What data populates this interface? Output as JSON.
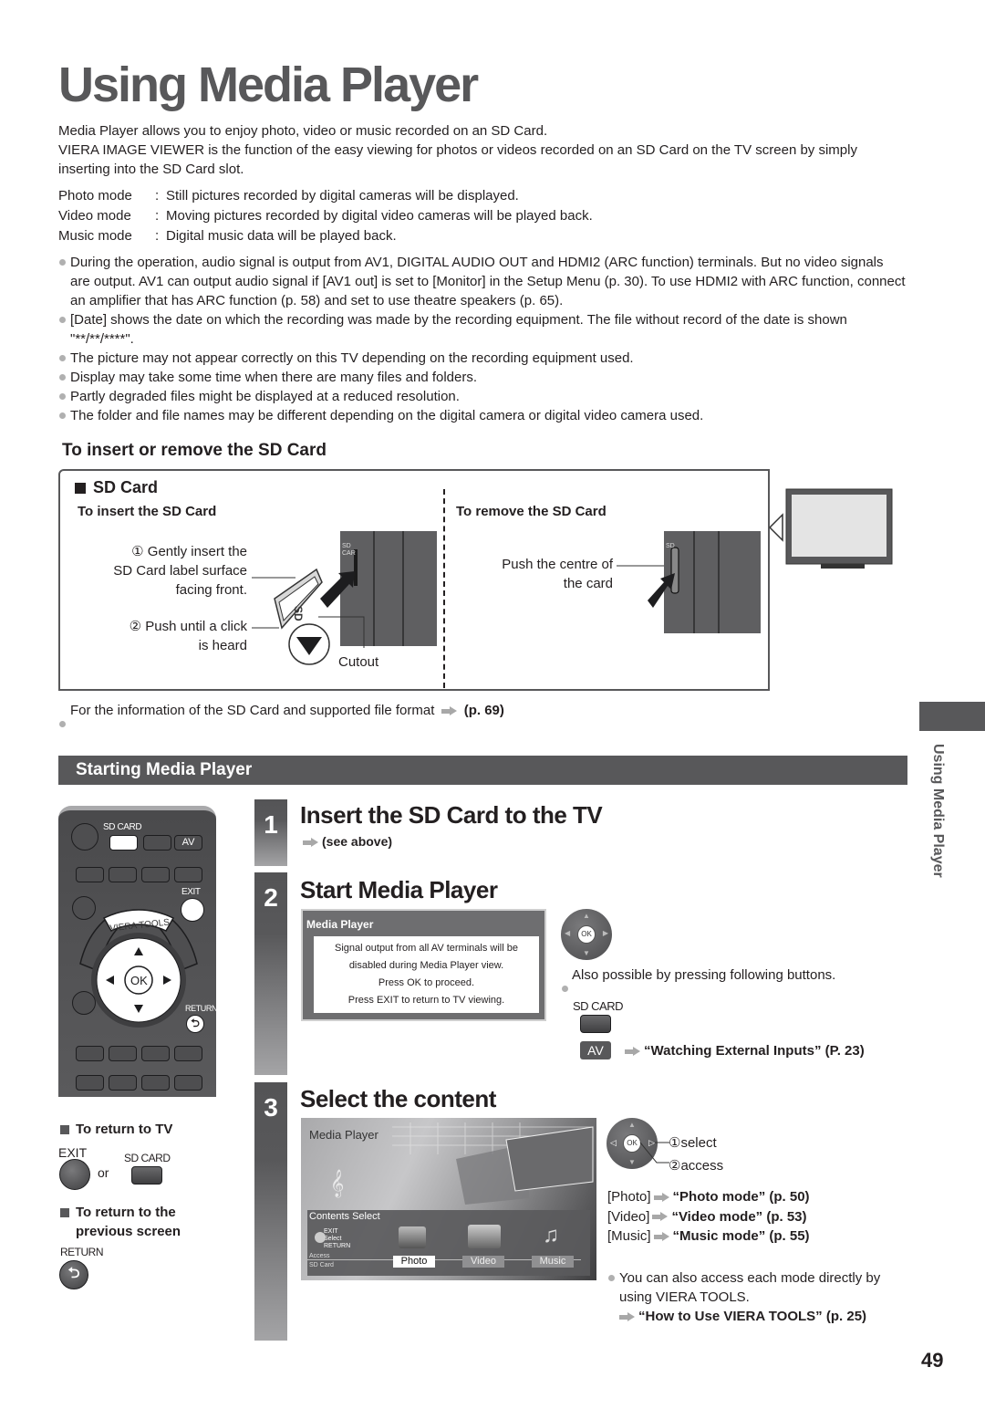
{
  "page": {
    "title": "Using Media Player",
    "side_tab_label": "Using Media Player",
    "page_number": "49"
  },
  "intro": {
    "lines": [
      "Media Player allows you to enjoy photo, video or music recorded on an SD Card.",
      "VIERA IMAGE VIEWER is the function of the easy viewing for photos or videos recorded on an SD Card on the TV screen by simply inserting into the SD Card slot."
    ],
    "modes": [
      {
        "name": "Photo mode",
        "desc": "Still pictures recorded by digital cameras will be displayed."
      },
      {
        "name": "Video mode",
        "desc": "Moving pictures recorded by digital video cameras will be played back."
      },
      {
        "name": "Music mode",
        "desc": "Digital music data will be played back."
      }
    ],
    "separator": ":",
    "notes": [
      "During the operation, audio signal is output from AV1, DIGITAL AUDIO OUT and HDMI2 (ARC function) terminals. But no video signals are output. AV1 can output audio signal if [AV1 out] is set to [Monitor] in the Setup Menu (p. 30). To use HDMI2 with ARC function, connect an amplifier that has ARC function (p. 58) and set to use theatre speakers (p. 65).",
      "[Date] shows the date on which the recording was made by the recording equipment. The file without record of the date is shown \"**/**/****\".",
      "The picture may not appear correctly on this TV depending on the recording equipment used.",
      "Display may take some time when there are many files and folders.",
      "Partly degraded files might be displayed at a reduced resolution.",
      "The folder and file names may be different depending on the digital camera or digital video camera used."
    ]
  },
  "sd_section": {
    "heading": "To insert or remove the SD Card",
    "box_label": "SD Card",
    "insert": {
      "heading": "To insert the SD Card",
      "step1_num": "①",
      "step1_lines": [
        "Gently insert the",
        "SD Card label surface",
        "facing front."
      ],
      "step2_num": "②",
      "step2_lines": [
        "Push until a click",
        "is heard"
      ],
      "cutout_label": "Cutout",
      "slot_label": "SD CAR"
    },
    "remove": {
      "heading": "To remove the SD Card",
      "lines": [
        "Push the centre of",
        "the card"
      ],
      "slot_label": "SD C"
    },
    "note": "For the information of the SD Card and supported file format",
    "note_ref": "(p. 69)"
  },
  "starting": {
    "bar_title": "Starting Media Player",
    "remote": {
      "sd_card": "SD CARD",
      "av": "AV",
      "exit": "EXIT",
      "viera_tools": "VIERA TOOLS",
      "ok": "OK",
      "return": "RETURN"
    },
    "return_tv": {
      "heading": "To return to TV",
      "exit_label": "EXIT",
      "or": "or",
      "sd_label": "SD CARD"
    },
    "return_prev": {
      "heading_line1": "To return to the",
      "heading_line2": "previous screen",
      "return_label": "RETURN"
    },
    "steps": [
      {
        "num": "1",
        "title": "Insert the SD Card to the TV",
        "ref": "(see above)"
      },
      {
        "num": "2",
        "title": "Start Media Player"
      },
      {
        "num": "3",
        "title": "Select the content"
      }
    ],
    "dialog": {
      "title": "Media Player",
      "lines": [
        "Signal output from all AV terminals will be",
        "disabled during Media Player view.",
        "Press OK to proceed.",
        "Press EXIT to return to TV viewing."
      ]
    },
    "step2_side": {
      "ok": "OK",
      "also": "Also possible by pressing following buttons.",
      "sd_card": "SD CARD",
      "av": "AV",
      "av_ref": "“Watching External Inputs” (P. 23)"
    },
    "content_screen": {
      "title": "Media Player",
      "panel_title": "Contents Select",
      "legend": [
        "EXIT",
        "Select",
        "RETURN"
      ],
      "access": "Access",
      "source": "SD Card",
      "tiles": [
        "Photo",
        "Video",
        "Music"
      ],
      "selected": "Photo"
    },
    "step3_side": {
      "ok": "OK",
      "select_num": "①",
      "select": "select",
      "access_num": "②",
      "access": "access",
      "refs": [
        {
          "tag": "[Photo]",
          "ref": "“Photo mode” (p. 50)"
        },
        {
          "tag": "[Video]",
          "ref": "“Video mode” (p. 53)"
        },
        {
          "tag": "[Music]",
          "ref": "“Music mode” (p. 55)"
        }
      ],
      "note_lines": [
        "You can also access each mode directly by",
        "using VIERA TOOLS."
      ],
      "note_ref": "“How to Use VIERA TOOLS” (p. 25)"
    }
  },
  "colors": {
    "title_grey": "#58585a",
    "bar_grey": "#58585a",
    "bullet_grey": "#b0b0b0",
    "arrow_grey": "#a8a8a8"
  }
}
